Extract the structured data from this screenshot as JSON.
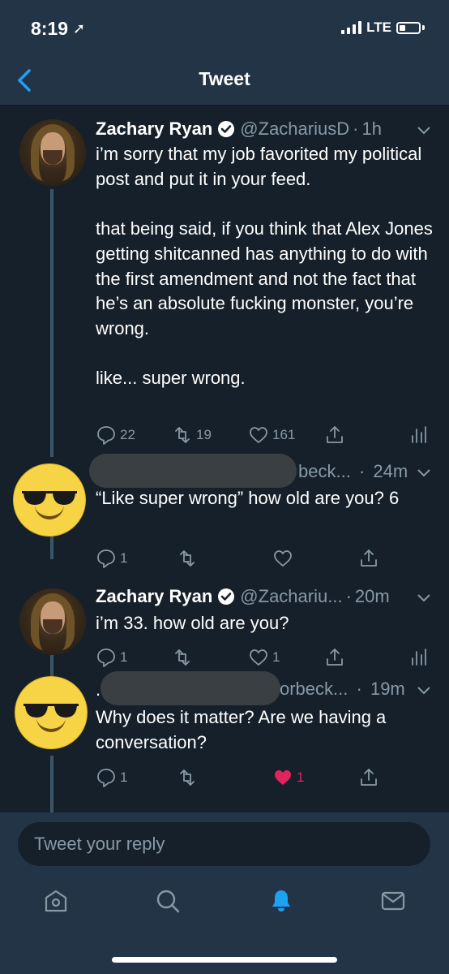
{
  "status": {
    "time": "8:19",
    "network": "LTE"
  },
  "nav": {
    "title": "Tweet"
  },
  "tweets": [
    {
      "name": "Zachary Ryan",
      "handle": "@ZachariusD",
      "time": "1h",
      "avatar": "profile-photo",
      "text": "i’m sorry that my job favorited my political post and put it in your feed.\n\nthat being said, if you think that Alex Jones getting shitcanned has anything to do with the first amendment and not the fact that he’s an absolute fucking monster, you’re wrong.\n\nlike... super wrong.",
      "replies": "22",
      "retweets": "19",
      "likes": "161"
    },
    {
      "handle_tail": "beck...",
      "time": "24m",
      "avatar": "sunglasses-emoji",
      "text": "“Like super wrong” how old are you? 6",
      "replies": "1",
      "retweets": "",
      "likes": ""
    },
    {
      "name": "Zachary Ryan",
      "handle": "@Zachariu...",
      "time": "20m",
      "avatar": "profile-photo",
      "text": "i’m 33. how old are you?",
      "replies": "1",
      "retweets": "",
      "likes": "1"
    },
    {
      "name_initial": ".",
      "handle_tail": "orbeck...",
      "time": "19m",
      "avatar": "sunglasses-emoji",
      "text": "Why does it matter? Are we having a conversation?",
      "replies": "1",
      "retweets": "",
      "likes": "1",
      "liked": true
    }
  ],
  "composer": {
    "placeholder": "Tweet your reply"
  },
  "colors": {
    "background": "#15202b",
    "bar": "#243447",
    "secondary_text": "#8899a6",
    "accent": "#1da1f2",
    "like": "#e0245e"
  }
}
